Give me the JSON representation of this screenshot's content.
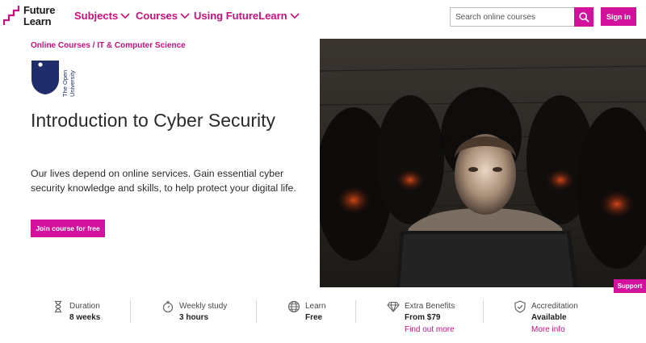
{
  "header": {
    "logo_line1": "Future",
    "logo_line2": "Learn",
    "nav": [
      {
        "label": "Subjects"
      },
      {
        "label": "Courses"
      },
      {
        "label": "Using FutureLearn"
      }
    ],
    "search_placeholder": "Search online courses",
    "signin_label": "Sign in"
  },
  "breadcrumb": {
    "item1": "Online Courses",
    "sep": " / ",
    "item2": "IT & Computer Science"
  },
  "partner": {
    "name_line1": "The Open",
    "name_line2": "University"
  },
  "course": {
    "title": "Introduction to Cyber Security",
    "description": "Our lives depend on online services. Gain essential cyber security knowledge and skills, to help protect your digital life.",
    "join_label": "Join course for free"
  },
  "support_label": "Support",
  "info": [
    {
      "icon": "hourglass-icon",
      "label": "Duration",
      "value": "8 weeks",
      "link": ""
    },
    {
      "icon": "stopwatch-icon",
      "label": "Weekly study",
      "value": "3 hours",
      "link": ""
    },
    {
      "icon": "globe-icon",
      "label": "Learn",
      "value": "Free",
      "link": ""
    },
    {
      "icon": "diamond-icon",
      "label": "Extra Benefits",
      "value": "From $79",
      "link": "Find out more"
    },
    {
      "icon": "shield-check-icon",
      "label": "Accreditation",
      "value": "Available",
      "link": "More info"
    }
  ],
  "colors": {
    "brand": "#d2129d",
    "brand_text": "#c5117e",
    "ou_blue": "#1f2d6a"
  }
}
